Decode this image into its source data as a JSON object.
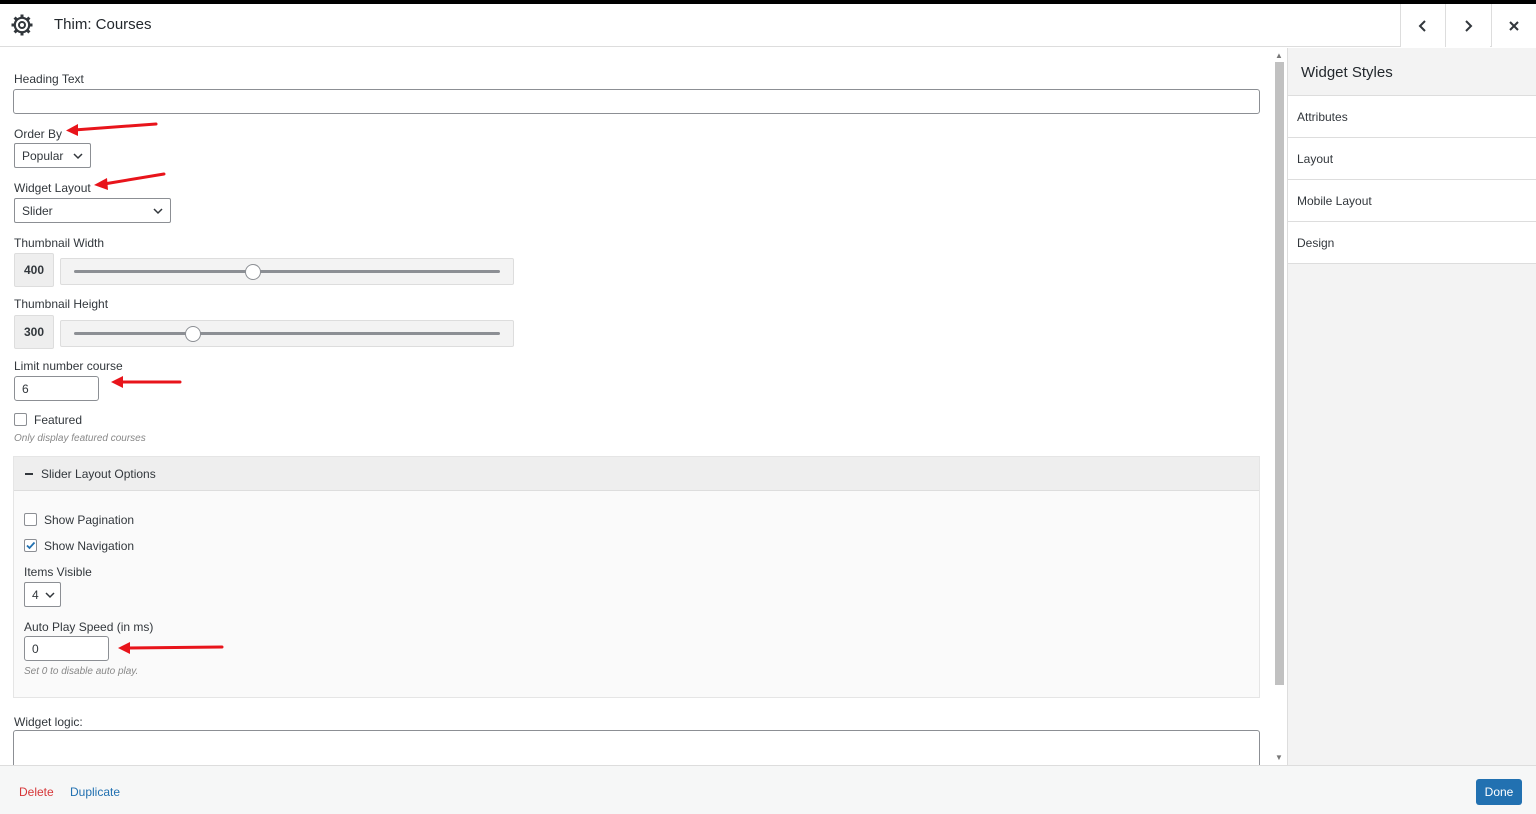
{
  "header": {
    "title": "Thim: Courses",
    "icons": {
      "settings": "gear-icon",
      "prev": "chevron-left-icon",
      "next": "chevron-right-icon",
      "close": "close-icon"
    }
  },
  "form": {
    "heading_text": {
      "label": "Heading Text",
      "value": ""
    },
    "order_by": {
      "label": "Order By",
      "selected": "Popular"
    },
    "widget_layout": {
      "label": "Widget Layout",
      "selected": "Slider"
    },
    "thumbnail_width": {
      "label": "Thumbnail Width",
      "value": "400",
      "level": 0.42
    },
    "thumbnail_height": {
      "label": "Thumbnail Height",
      "value": "300",
      "level": 0.28
    },
    "limit_number_course": {
      "label": "Limit number course",
      "value": "6"
    },
    "featured": {
      "label": "Featured",
      "checked": false,
      "hint": "Only display featured courses"
    },
    "slider_section": {
      "title": "Slider Layout Options",
      "show_pagination": {
        "label": "Show Pagination",
        "checked": false
      },
      "show_navigation": {
        "label": "Show Navigation",
        "checked": true
      },
      "items_visible": {
        "label": "Items Visible",
        "selected": "4"
      },
      "auto_play_speed": {
        "label": "Auto Play Speed (in ms)",
        "value": "0",
        "hint": "Set 0 to disable auto play."
      }
    },
    "widget_logic": {
      "label": "Widget logic:",
      "value": ""
    }
  },
  "sidebar": {
    "title": "Widget Styles",
    "items": [
      {
        "label": "Attributes"
      },
      {
        "label": "Layout"
      },
      {
        "label": "Mobile Layout"
      },
      {
        "label": "Design"
      }
    ]
  },
  "footer": {
    "delete_label": "Delete",
    "duplicate_label": "Duplicate",
    "done_label": "Done"
  },
  "colors": {
    "annotation_arrow": "#e8141b",
    "primary": "#2271b1",
    "danger": "#d63638"
  }
}
